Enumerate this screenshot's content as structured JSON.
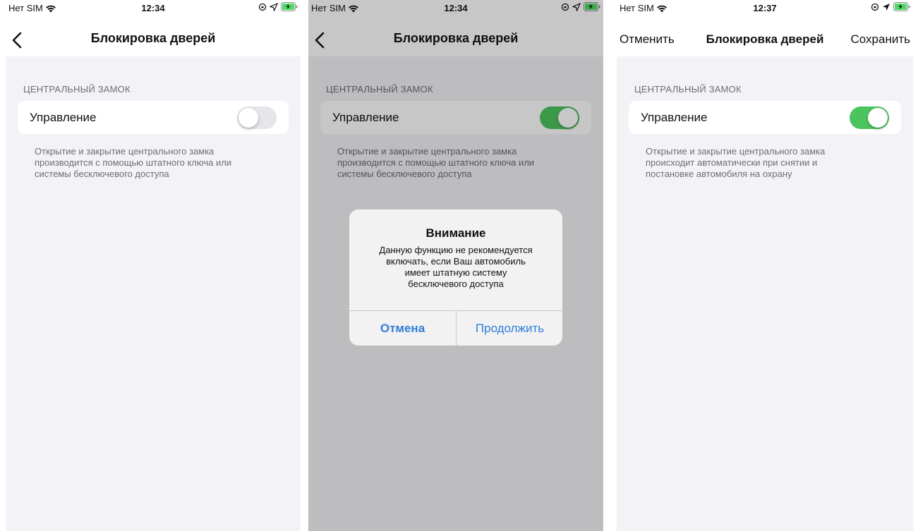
{
  "colors": {
    "background": "#f2f2f7",
    "toggle_on": "#4cc45e",
    "toggle_off": "#e5e5ea",
    "accent": "#2f7fd9"
  },
  "screens": [
    {
      "status": {
        "carrier": "Нет SIM",
        "time": "12:34"
      },
      "nav": {
        "title": "Блокировка дверей",
        "back_icon": "chevron-left-icon"
      },
      "section_header": "ЦЕНТРАЛЬНЫЙ ЗАМОК",
      "cell": {
        "label": "Управление",
        "toggle_on": false
      },
      "footer": [
        "Открытие и закрытие центрального замка",
        "производится с помощью штатного ключа или",
        "системы бесключевого доступа"
      ]
    },
    {
      "status": {
        "carrier": "Нет SIM",
        "time": "12:34"
      },
      "nav": {
        "title": "Блокировка дверей",
        "back_icon": "chevron-left-icon"
      },
      "section_header": "ЦЕНТРАЛЬНЫЙ ЗАМОК",
      "cell": {
        "label": "Управление",
        "toggle_on": true
      },
      "footer": [
        "Открытие и закрытие центрального замка",
        "производится с помощью штатного ключа или",
        "системы бесключевого доступа"
      ],
      "alert": {
        "title": "Внимание",
        "message": [
          "Данную функцию не рекомендуется",
          "включать, если Ваш автомобиль",
          "имеет штатную систему",
          "бесключевого доступа"
        ],
        "cancel_label": "Отмена",
        "continue_label": "Продолжить"
      }
    },
    {
      "status": {
        "carrier": "Нет SIM",
        "time": "12:37"
      },
      "nav": {
        "title": "Блокировка дверей",
        "cancel_label": "Отменить",
        "save_label": "Сохранить"
      },
      "section_header": "ЦЕНТРАЛЬНЫЙ ЗАМОК",
      "cell": {
        "label": "Управление",
        "toggle_on": true
      },
      "footer": [
        "Открытие и закрытие центрального замка",
        "происходит автоматически при снятии и",
        "постановке автомобиля на охрану"
      ]
    }
  ]
}
